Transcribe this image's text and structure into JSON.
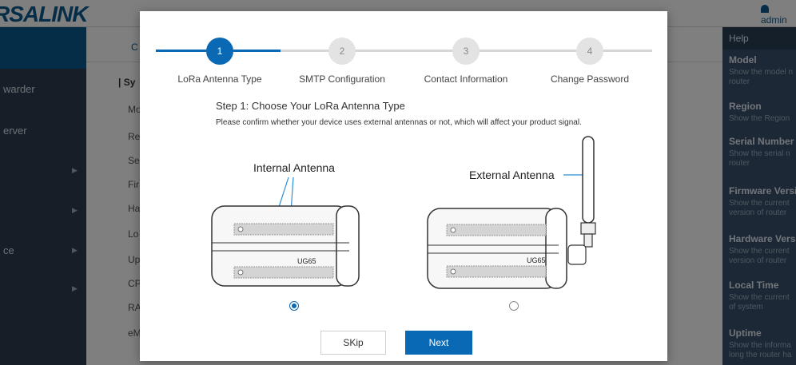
{
  "app": {
    "brand": "RSALINK",
    "user_name": "admin"
  },
  "sidebar": {
    "items": [
      {
        "label": "warder"
      },
      {
        "label": "erver"
      },
      {
        "label": ""
      },
      {
        "label": ""
      },
      {
        "label": "ce"
      },
      {
        "label": ""
      }
    ]
  },
  "content": {
    "tab_letter": "C",
    "section_title": "Sy",
    "field_labels": [
      "Mo",
      "Re",
      "Se",
      "Fir",
      "Ha",
      "Lo",
      "Up",
      "CP",
      "RA",
      "eM"
    ]
  },
  "help": {
    "title": "Help",
    "sections": [
      {
        "heading": "Model",
        "desc": "Show the model n\nrouter"
      },
      {
        "heading": "Region",
        "desc": "Show the Region"
      },
      {
        "heading": "Serial Number",
        "desc": "Show the serial n\nrouter"
      },
      {
        "heading": "Firmware Versi",
        "desc": "Show the current\nversion of router"
      },
      {
        "heading": "Hardware Versi",
        "desc": "Show the current\nversion of router"
      },
      {
        "heading": "Local Time",
        "desc": "Show the current\nof system"
      },
      {
        "heading": "Uptime",
        "desc": "Show the informa\nlong the router ha"
      }
    ]
  },
  "wizard": {
    "steps": [
      {
        "number": "1",
        "label": "LoRa Antenna Type",
        "state": "active"
      },
      {
        "number": "2",
        "label": "SMTP Configuration",
        "state": "inactive"
      },
      {
        "number": "3",
        "label": "Contact Information",
        "state": "inactive"
      },
      {
        "number": "4",
        "label": "Change Password",
        "state": "inactive"
      }
    ],
    "heading": "Step 1: Choose Your LoRa Antenna Type",
    "description": "Please confirm whether your device uses external antennas or not, which will affect your product signal.",
    "options": [
      {
        "label": "Internal Antenna",
        "model": "UG65",
        "selected": true
      },
      {
        "label": "External Antenna",
        "model": "UG65",
        "selected": false
      }
    ],
    "buttons": {
      "skip": "SKip",
      "next": "Next"
    }
  },
  "colors": {
    "primary": "#0a69b5",
    "brand": "#0a5a8e",
    "sidebar": "#2c3e50",
    "help_panel": "#39516a"
  }
}
